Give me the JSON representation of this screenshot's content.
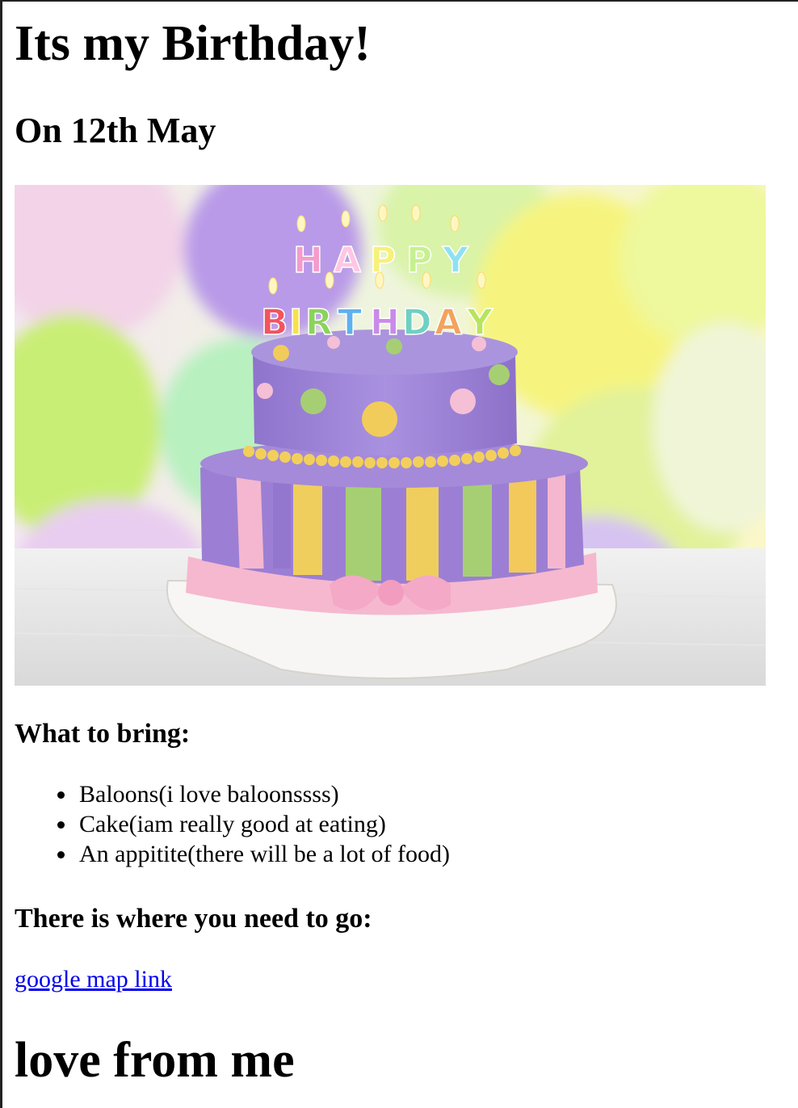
{
  "page": {
    "title": "Its my Birthday!",
    "subtitle": "On 12th May"
  },
  "image": {
    "subject": "birthday-cake-photo",
    "cake_text_top": "HAPPY",
    "cake_text_bottom": "BIRTHDAY",
    "colors": {
      "purple": "#9d7fd6",
      "pink": "#f7b6cf",
      "yellow": "#f1d15c",
      "green": "#a7cf6b",
      "board": "#f3f1ee"
    }
  },
  "bring": {
    "heading": "What to bring:",
    "items": [
      "Baloons(i love baloonssss)",
      "Cake(iam really good at eating)",
      "An appitite(there will be a lot of food)"
    ]
  },
  "location": {
    "heading": "There is where you need to go:",
    "link_text": "google map link"
  },
  "footer": {
    "signoff": "love from me"
  }
}
